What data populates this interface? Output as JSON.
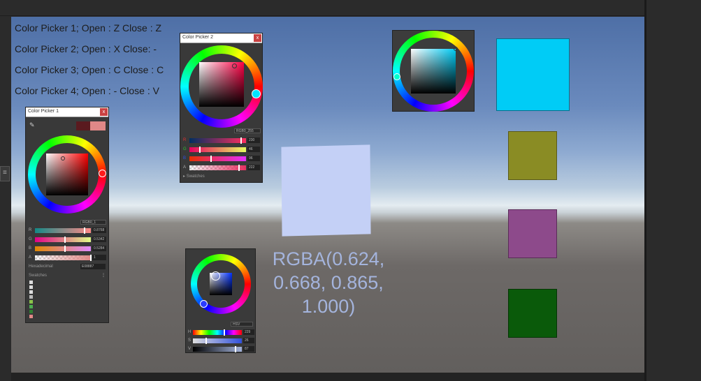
{
  "instructions": [
    "Color Picker 1; Open : Z Close : Z",
    "Color Picker 2; Open : X Close: -",
    "Color Picker 3; Open : C Close : C",
    "Color Picker 4; Open : - Close : V"
  ],
  "picker1": {
    "title": "Color Picker 1",
    "close": "x",
    "mode": "RGB0_1",
    "rows": [
      {
        "label": "R",
        "value": "0.8768"
      },
      {
        "label": "G",
        "value": "0.5342"
      },
      {
        "label": "B",
        "value": "0.5284"
      },
      {
        "label": "A",
        "value": "1"
      }
    ],
    "hex_label": "Hexadecimal",
    "hex_value": "E08887",
    "swatches_label": "Swatches",
    "colors": {
      "current": "#e08887",
      "previous": "#5a1a1f"
    }
  },
  "picker2": {
    "title": "Color Picker 2",
    "close": "x",
    "mode": "RGB0_255",
    "rows": [
      {
        "label": "R",
        "value": "230"
      },
      {
        "label": "G",
        "value": "46"
      },
      {
        "label": "B",
        "value": "96"
      },
      {
        "label": "A",
        "value": "222"
      }
    ],
    "swatches_label": "Swatches"
  },
  "picker4": {
    "mode": "HSV",
    "rows": [
      {
        "label": "H",
        "value": "229"
      },
      {
        "label": "S",
        "value": "26"
      },
      {
        "label": "V",
        "value": "87"
      }
    ]
  },
  "rgba_text": "RGBA(0.624, 0.668, 0.865, 1.000)",
  "scene_colors": {
    "plane": "#c4d0f6",
    "cyan_square": "#00ccf6",
    "olive_square": "#8a8c24",
    "purple_square": "#8d4a8b",
    "green_square": "#0a5a0a"
  }
}
